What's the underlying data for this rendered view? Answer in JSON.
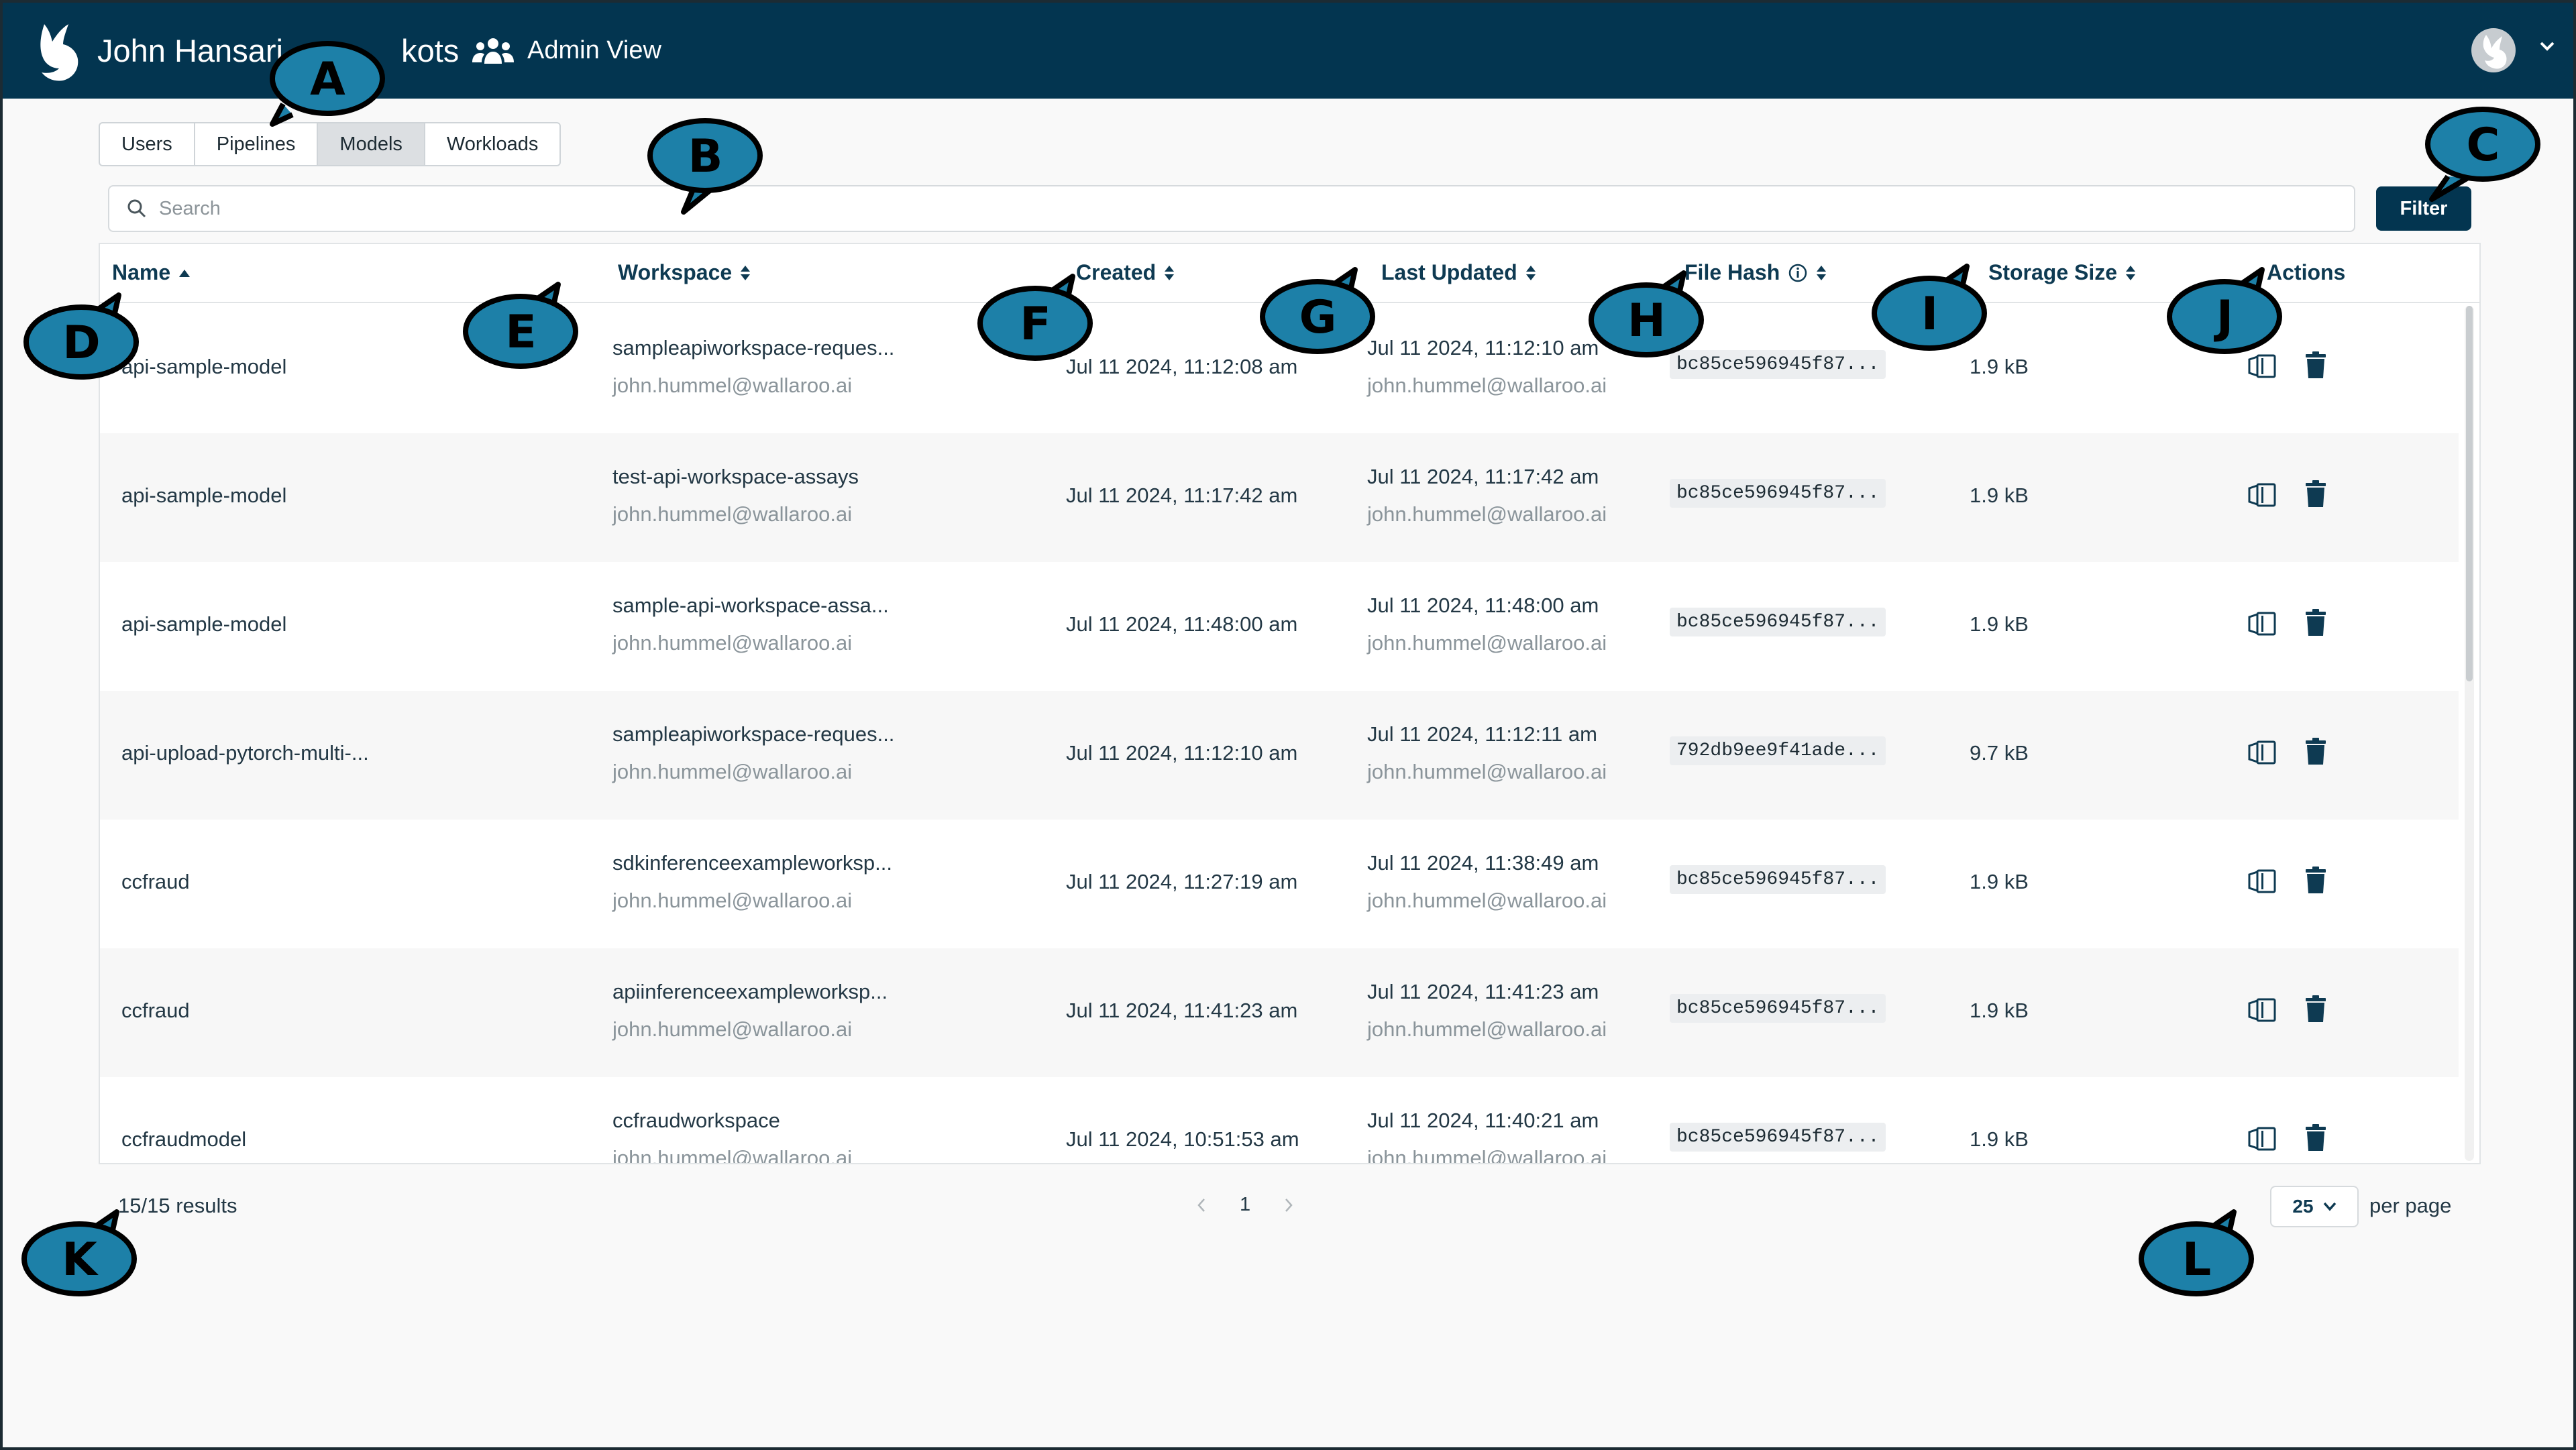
{
  "header": {
    "user_name_left": "John Hansari",
    "user_name_right": "kots",
    "admin_view": "Admin View"
  },
  "tabs": [
    {
      "label": "Users",
      "active": false
    },
    {
      "label": "Pipelines",
      "active": false
    },
    {
      "label": "Models",
      "active": true
    },
    {
      "label": "Workloads",
      "active": false
    }
  ],
  "search": {
    "placeholder": "Search"
  },
  "filter_label": "Filter",
  "columns": {
    "name": "Name",
    "workspace": "Workspace",
    "created": "Created",
    "last_updated": "Last Updated",
    "file_hash": "File Hash",
    "storage_size": "Storage Size",
    "actions": "Actions"
  },
  "rows": [
    {
      "name": "api-sample-model",
      "workspace": "sampleapiworkspace-reques...",
      "workspace_owner": "john.hummel@wallaroo.ai",
      "created": "Jul 11 2024, 11:12:08 am",
      "updated": "Jul 11 2024, 11:12:10 am",
      "updated_by": "john.hummel@wallaroo.ai",
      "hash": "bc85ce596945f87...",
      "size": "1.9 kB"
    },
    {
      "name": "api-sample-model",
      "workspace": "test-api-workspace-assays",
      "workspace_owner": "john.hummel@wallaroo.ai",
      "created": "Jul 11 2024, 11:17:42 am",
      "updated": "Jul 11 2024, 11:17:42 am",
      "updated_by": "john.hummel@wallaroo.ai",
      "hash": "bc85ce596945f87...",
      "size": "1.9 kB"
    },
    {
      "name": "api-sample-model",
      "workspace": "sample-api-workspace-assa...",
      "workspace_owner": "john.hummel@wallaroo.ai",
      "created": "Jul 11 2024, 11:48:00 am",
      "updated": "Jul 11 2024, 11:48:00 am",
      "updated_by": "john.hummel@wallaroo.ai",
      "hash": "bc85ce596945f87...",
      "size": "1.9 kB"
    },
    {
      "name": "api-upload-pytorch-multi-...",
      "workspace": "sampleapiworkspace-reques...",
      "workspace_owner": "john.hummel@wallaroo.ai",
      "created": "Jul 11 2024, 11:12:10 am",
      "updated": "Jul 11 2024, 11:12:11 am",
      "updated_by": "john.hummel@wallaroo.ai",
      "hash": "792db9ee9f41ade...",
      "size": "9.7 kB"
    },
    {
      "name": "ccfraud",
      "workspace": "sdkinferenceexampleworksp...",
      "workspace_owner": "john.hummel@wallaroo.ai",
      "created": "Jul 11 2024, 11:27:19 am",
      "updated": "Jul 11 2024, 11:38:49 am",
      "updated_by": "john.hummel@wallaroo.ai",
      "hash": "bc85ce596945f87...",
      "size": "1.9 kB"
    },
    {
      "name": "ccfraud",
      "workspace": "apiinferenceexampleworksp...",
      "workspace_owner": "john.hummel@wallaroo.ai",
      "created": "Jul 11 2024, 11:41:23 am",
      "updated": "Jul 11 2024, 11:41:23 am",
      "updated_by": "john.hummel@wallaroo.ai",
      "hash": "bc85ce596945f87...",
      "size": "1.9 kB"
    },
    {
      "name": "ccfraudmodel",
      "workspace": "ccfraudworkspace",
      "workspace_owner": "john.hummel@wallaroo.ai",
      "created": "Jul 11 2024, 10:51:53 am",
      "updated": "Jul 11 2024, 11:40:21 am",
      "updated_by": "john.hummel@wallaroo.ai",
      "hash": "bc85ce596945f87...",
      "size": "1.9 kB"
    }
  ],
  "footer": {
    "results": "15/15 results",
    "current_page": "1",
    "per_page_value": "25",
    "per_page_label": "per page"
  },
  "callouts": [
    "A",
    "B",
    "C",
    "D",
    "E",
    "F",
    "G",
    "H",
    "I",
    "J",
    "K",
    "L"
  ],
  "colors": {
    "header_bg": "#033550",
    "callout_fill": "#1d80a8",
    "accent": "#0e3a52"
  },
  "icons": {
    "logo": "wallaroo-logo-icon",
    "admin": "users-group-icon",
    "sort": "sort-icon",
    "info": "info-icon",
    "view": "view-model-icon",
    "delete": "trash-icon"
  }
}
